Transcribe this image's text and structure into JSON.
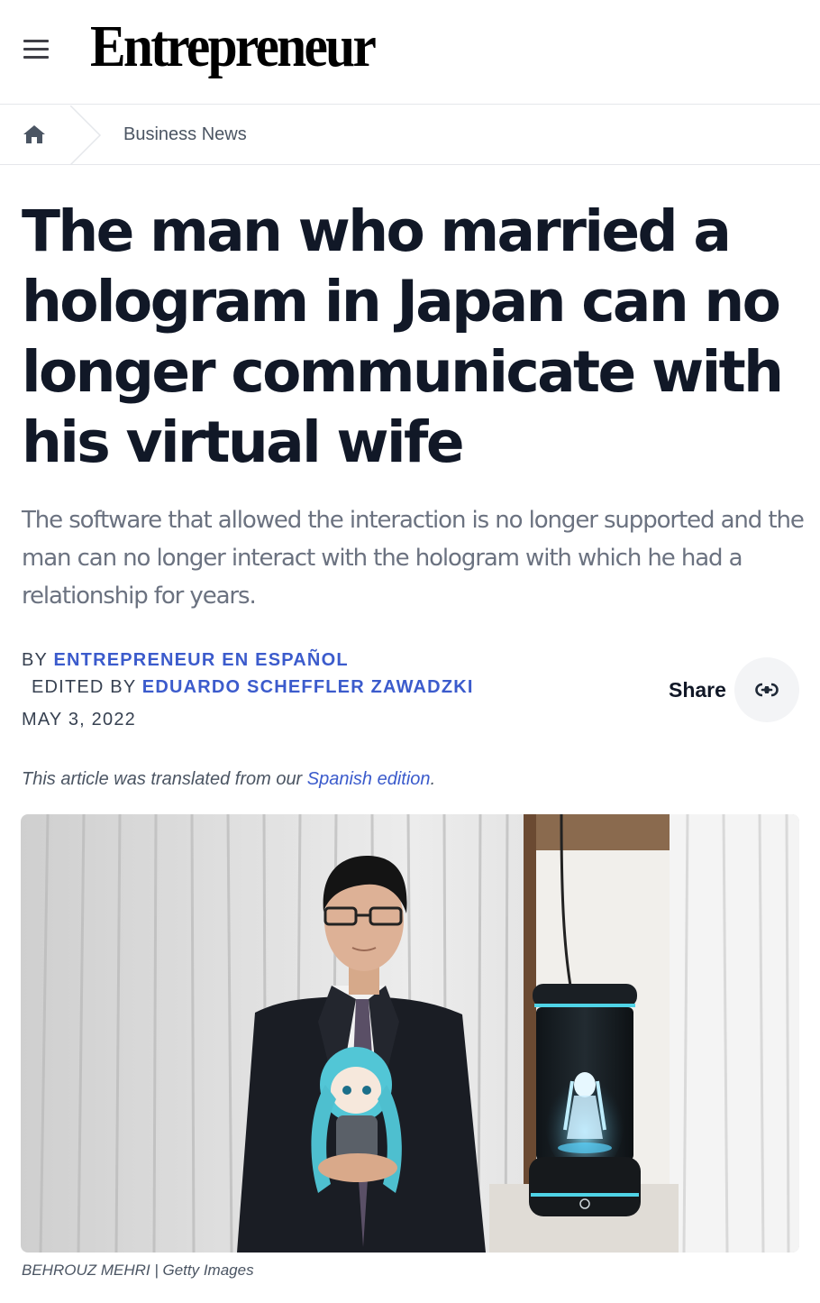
{
  "header": {
    "logo_text": "Entrepreneur",
    "logo_mark": "®",
    "menu_icon": "hamburger-menu-icon"
  },
  "breadcrumb": {
    "home_icon": "home-icon",
    "section": "Business News"
  },
  "article": {
    "headline": "The man who married a hologram in Japan can no longer communicate with his virtual wife",
    "dek": "The software that allowed the interaction is no longer supported and the man can no longer interact with the hologram with which he had a relationship for years.",
    "byline": {
      "by_prefix": "BY",
      "author": "ENTREPRENEUR EN ESPAÑOL",
      "edited_prefix": "EDITED BY",
      "editor": "EDUARDO SCHEFFLER ZAWADZKI",
      "date": "MAY 3, 2022"
    },
    "share": {
      "label": "Share",
      "icon": "link-icon"
    },
    "translation_note": {
      "before": "This article was translated from our ",
      "link_text": "Spanish edition",
      "after": "."
    },
    "image": {
      "caption": "BEHROUZ MEHRI | Getty Images"
    }
  },
  "colors": {
    "link": "#3b5bcc",
    "headline": "#111827",
    "dek": "#6b7280",
    "divider": "#e5e7eb"
  }
}
